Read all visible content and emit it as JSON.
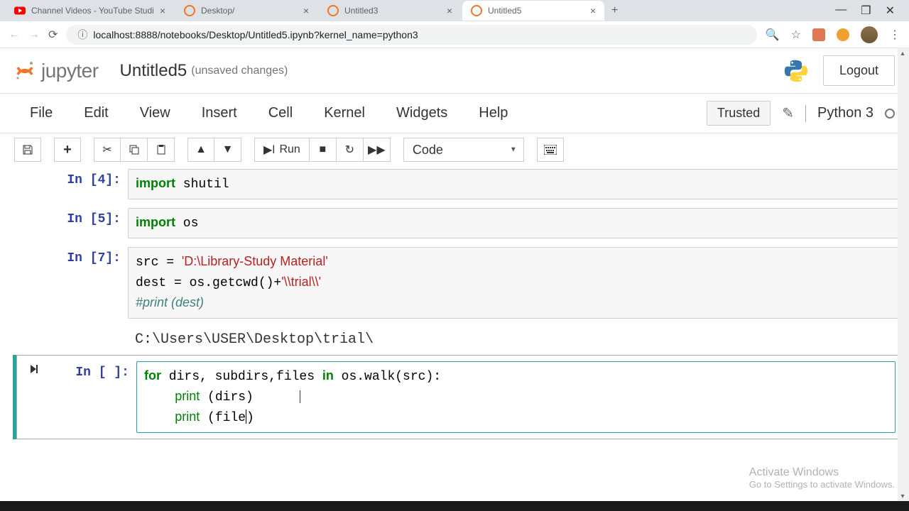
{
  "tabs": [
    {
      "title": "Channel Videos - YouTube Studi",
      "favicon": "youtube"
    },
    {
      "title": "Desktop/",
      "favicon": "jupyter"
    },
    {
      "title": "Untitled3",
      "favicon": "jupyter"
    },
    {
      "title": "Untitled5",
      "favicon": "jupyter",
      "active": true
    }
  ],
  "url": "localhost:8888/notebooks/Desktop/Untitled5.ipynb?kernel_name=python3",
  "jupyter": {
    "logo_text": "jupyter",
    "nb_title": "Untitled5",
    "unsaved": "(unsaved changes)",
    "logout": "Logout"
  },
  "menus": [
    "File",
    "Edit",
    "View",
    "Insert",
    "Cell",
    "Kernel",
    "Widgets",
    "Help"
  ],
  "trusted": "Trusted",
  "kernel": "Python 3",
  "toolbar": {
    "run": "Run",
    "celltype": "Code"
  },
  "cells": [
    {
      "prompt": "In [4]:"
    },
    {
      "prompt": "In [5]:"
    },
    {
      "prompt": "In [7]:"
    },
    {
      "output": "C:\\Users\\USER\\Desktop\\trial\\"
    },
    {
      "prompt": "In [ ]:"
    }
  ],
  "watermark": {
    "title": "Activate Windows",
    "sub": "Go to Settings to activate Windows."
  }
}
